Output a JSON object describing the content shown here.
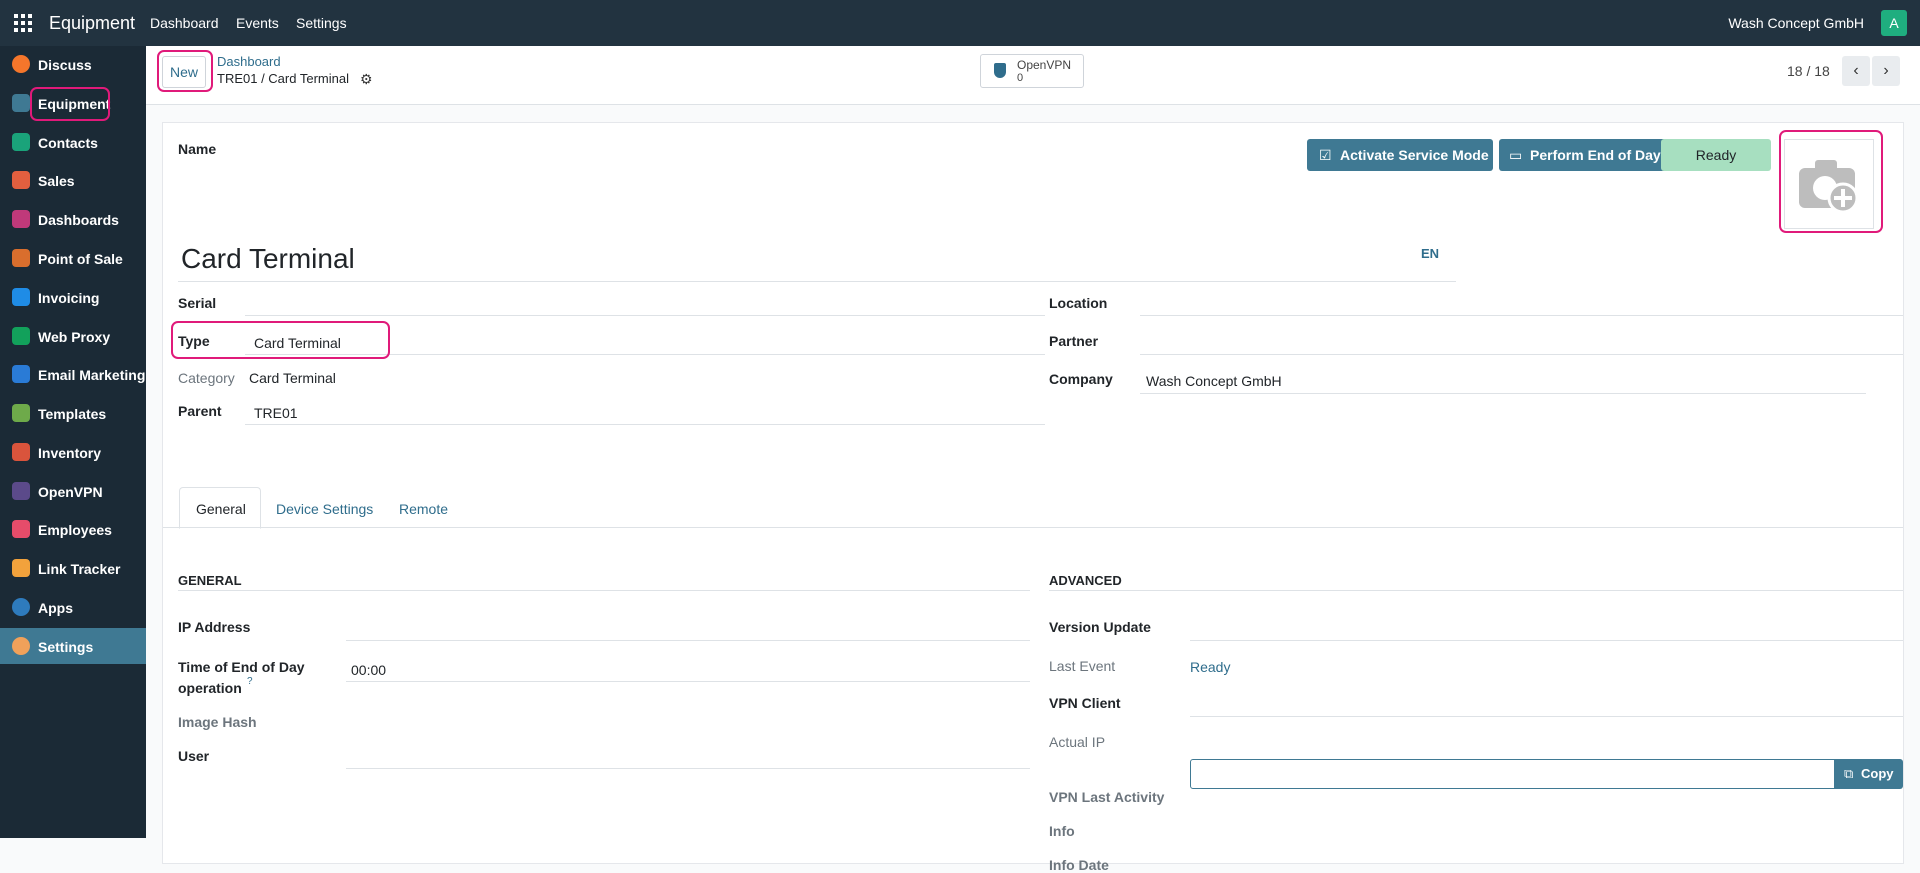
{
  "topbar": {
    "app_name": "Equipment",
    "menu": [
      "Dashboard",
      "Events",
      "Settings"
    ],
    "company": "Wash Concept GmbH",
    "avatar_letter": "A",
    "avatar_color": "#1fae7f"
  },
  "sidebar": {
    "items": [
      {
        "label": "Discuss",
        "icon": "discuss-icon",
        "color": "#f5762b"
      },
      {
        "label": "Equipment",
        "icon": "equipment-icon",
        "color": "#3f7993"
      },
      {
        "label": "Contacts",
        "icon": "contacts-icon",
        "color": "#1aa37a"
      },
      {
        "label": "Sales",
        "icon": "sales-icon",
        "color": "#e25f3f"
      },
      {
        "label": "Dashboards",
        "icon": "dashboards-icon",
        "color": "#c0397a"
      },
      {
        "label": "Point of Sale",
        "icon": "point-of-sale-icon",
        "color": "#d96e2d"
      },
      {
        "label": "Invoicing",
        "icon": "invoicing-icon",
        "color": "#1f8ce6"
      },
      {
        "label": "Web Proxy",
        "icon": "web-proxy-icon",
        "color": "#12a15b"
      },
      {
        "label": "Email Marketing",
        "icon": "email-marketing-icon",
        "color": "#2a7bd6"
      },
      {
        "label": "Templates",
        "icon": "templates-icon",
        "color": "#6eaa4a"
      },
      {
        "label": "Inventory",
        "icon": "inventory-icon",
        "color": "#d9543c"
      },
      {
        "label": "OpenVPN",
        "icon": "openvpn-icon",
        "color": "#5b4a8a"
      },
      {
        "label": "Employees",
        "icon": "employees-icon",
        "color": "#e64c6a"
      },
      {
        "label": "Link Tracker",
        "icon": "link-tracker-icon",
        "color": "#f2a23c"
      },
      {
        "label": "Apps",
        "icon": "apps-icon",
        "color": "#2e7bbd"
      },
      {
        "label": "Settings",
        "icon": "settings-icon",
        "color": "#f0a15a"
      }
    ],
    "active": "Equipment"
  },
  "control_panel": {
    "new_label": "New",
    "breadcrumb_parent": "Dashboard",
    "breadcrumb_current": "TRE01 / Card Terminal",
    "openvpn_label": "OpenVPN",
    "openvpn_count": "0",
    "pager": "18 / 18"
  },
  "form": {
    "name_label": "Name",
    "activate_service_label": "Activate Service Mode",
    "perform_eod_label": "Perform End of Day",
    "status_label": "Ready",
    "status_color": "#a7dfc0",
    "title": "Card Terminal",
    "lang": "EN",
    "left_fields": {
      "serial_label": "Serial",
      "type_label": "Type",
      "type_value": "Card Terminal",
      "category_label": "Category",
      "category_value": "Card Terminal",
      "parent_label": "Parent",
      "parent_value": "TRE01"
    },
    "right_fields": {
      "location_label": "Location",
      "partner_label": "Partner",
      "company_label": "Company",
      "company_value": "Wash Concept GmbH"
    },
    "tabs": [
      "General",
      "Device Settings",
      "Remote"
    ],
    "general": {
      "section_title": "GENERAL",
      "ip_label": "IP Address",
      "eod_label_line1": "Time of End of Day",
      "eod_label_line2": "operation",
      "eod_help": "?",
      "eod_value": "00:00",
      "image_hash_label": "Image Hash",
      "user_label": "User"
    },
    "advanced": {
      "section_title": "ADVANCED",
      "version_update_label": "Version Update",
      "last_event_label": "Last Event",
      "last_event_value": "Ready",
      "vpn_client_label": "VPN Client",
      "actual_ip_label": "Actual IP",
      "copy_label": "Copy",
      "vpn_last_activity_label": "VPN Last Activity",
      "info_label": "Info",
      "info_date_label": "Info Date"
    }
  },
  "accent_color": "#3f7993",
  "highlight_color": "#e01a7a"
}
